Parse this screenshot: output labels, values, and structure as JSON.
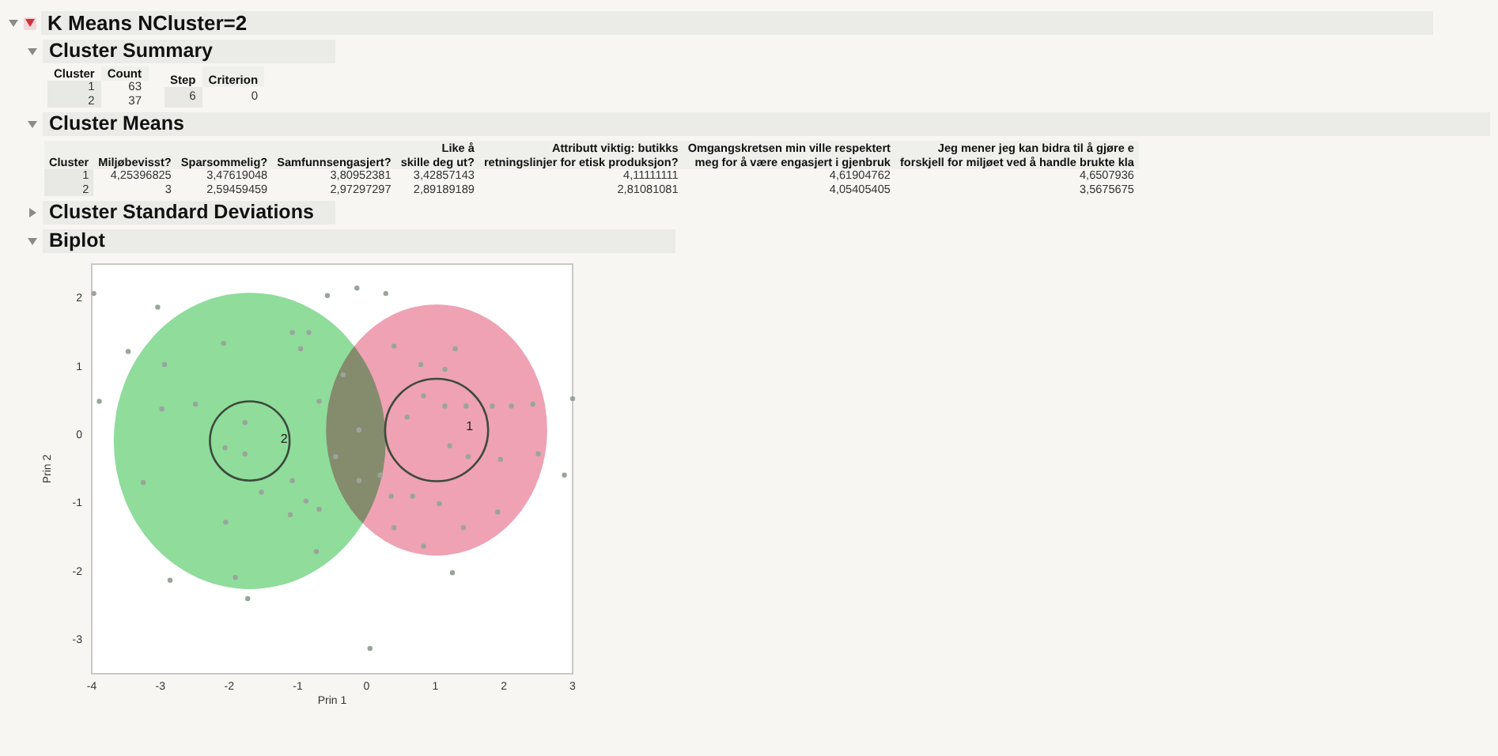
{
  "report": {
    "title": "K Means NCluster=2",
    "expanded": true
  },
  "cluster_summary": {
    "title": "Cluster Summary",
    "expanded": true,
    "tables": [
      {
        "columns": [
          "Cluster",
          "Count"
        ],
        "rows": [
          [
            "1",
            "63"
          ],
          [
            "2",
            "37"
          ]
        ]
      },
      {
        "columns": [
          "Step",
          "Criterion"
        ],
        "rows": [
          [
            "6",
            "0"
          ]
        ]
      }
    ]
  },
  "cluster_means": {
    "title": "Cluster Means",
    "expanded": true,
    "columns": [
      {
        "lines": [
          "Cluster"
        ]
      },
      {
        "lines": [
          "Miljøbevisst?"
        ]
      },
      {
        "lines": [
          "Sparsommelig?"
        ]
      },
      {
        "lines": [
          "Samfunnsengasjert?"
        ]
      },
      {
        "lines": [
          "Like å",
          "skille deg ut?"
        ]
      },
      {
        "lines": [
          "Attributt viktig: butikks",
          "retningslinjer for etisk produksjon?"
        ]
      },
      {
        "lines": [
          "Omgangskretsen min ville respektert",
          "meg for å være engasjert i gjenbruk"
        ]
      },
      {
        "lines": [
          "Jeg mener jeg kan bidra til å gjøre e",
          "forskjell for miljøet ved å handle brukte kla"
        ]
      }
    ],
    "rows": [
      [
        "1",
        "4,25396825",
        "3,47619048",
        "3,80952381",
        "3,42857143",
        "4,11111111",
        "4,61904762",
        "4,6507936"
      ],
      [
        "2",
        "3",
        "2,59459459",
        "2,97297297",
        "2,89189189",
        "2,81081081",
        "4,05405405",
        "3,5675675"
      ]
    ]
  },
  "cluster_std": {
    "title": "Cluster Standard Deviations",
    "expanded": false
  },
  "biplot": {
    "title": "Biplot",
    "expanded": true,
    "clusters": [
      {
        "label": "2",
        "color": "#8fdc9b"
      },
      {
        "label": "1",
        "color": "#eea2b4"
      }
    ],
    "chart_data": {
      "type": "scatter",
      "xlabel": "Prin 1",
      "ylabel": "Prin 2",
      "xlim": [
        -4,
        3
      ],
      "ylim": [
        -3.52,
        2.48
      ],
      "xticks": [
        {
          "value": -4,
          "label": "-4"
        },
        {
          "value": -3,
          "label": "-3"
        },
        {
          "value": -2,
          "label": "-2"
        },
        {
          "value": -1,
          "label": "-1"
        },
        {
          "value": 0,
          "label": "0"
        },
        {
          "value": 1,
          "label": "1"
        },
        {
          "value": 2,
          "label": "2"
        },
        {
          "value": 3,
          "label": "3"
        }
      ],
      "yticks": [
        {
          "value": -3,
          "label": "-3"
        },
        {
          "value": -2,
          "label": "-2"
        },
        {
          "value": -1,
          "label": "-1"
        },
        {
          "value": 0,
          "label": "0"
        },
        {
          "value": 1,
          "label": "1"
        },
        {
          "value": 2,
          "label": "2"
        }
      ],
      "x": [
        -3.97,
        -3.04,
        -3.47,
        -3.89,
        -2.94,
        -2.98,
        -3.25,
        -2.86,
        -2.08,
        -2.49,
        -2.05,
        -1.91,
        -1.73,
        -1.77,
        -2.06,
        -1.77,
        -1.53,
        -1.08,
        -0.84,
        -0.96,
        -1.08,
        -1.11,
        -0.88,
        -0.69,
        -0.73,
        -0.69,
        -0.57,
        -0.14,
        0.28,
        -0.34,
        -0.11,
        -0.45,
        -0.11,
        0.05,
        0.2,
        0.4,
        0.36,
        0.4,
        0.59,
        0.83,
        0.79,
        1.14,
        0.67,
        0.83,
        1.06,
        1.29,
        1.14,
        1.21,
        1.45,
        1.48,
        1.41,
        1.83,
        1.95,
        1.91,
        2.11,
        2.42,
        2.5,
        1.25,
        2.88,
        3.0
      ],
      "series": [
        {
          "color": "#9aa59a",
          "values": [
            2.05,
            1.85,
            1.2,
            0.47,
            1.01,
            0.36,
            -0.72,
            -2.15,
            1.32,
            0.43,
            -1.3,
            -2.11,
            -2.42,
            0.16,
            -0.21,
            -0.3,
            -0.86,
            1.48,
            1.48,
            1.24,
            -0.69,
            -1.19,
            -0.99,
            -1.11,
            -1.73,
            0.47,
            2.02,
            2.13,
            2.05,
            0.86,
            0.05,
            -0.34,
            -0.69,
            -3.15,
            -0.61,
            1.28,
            -0.92,
            -1.38,
            0.24,
            0.55,
            1.01,
            0.94,
            -0.92,
            -1.65,
            -1.03,
            1.24,
            0.4,
            -0.18,
            0.4,
            -0.34,
            -1.38,
            0.4,
            -0.38,
            -1.15,
            0.4,
            0.43,
            -0.3,
            -2.04,
            -0.61,
            0.51
          ]
        }
      ]
    }
  }
}
